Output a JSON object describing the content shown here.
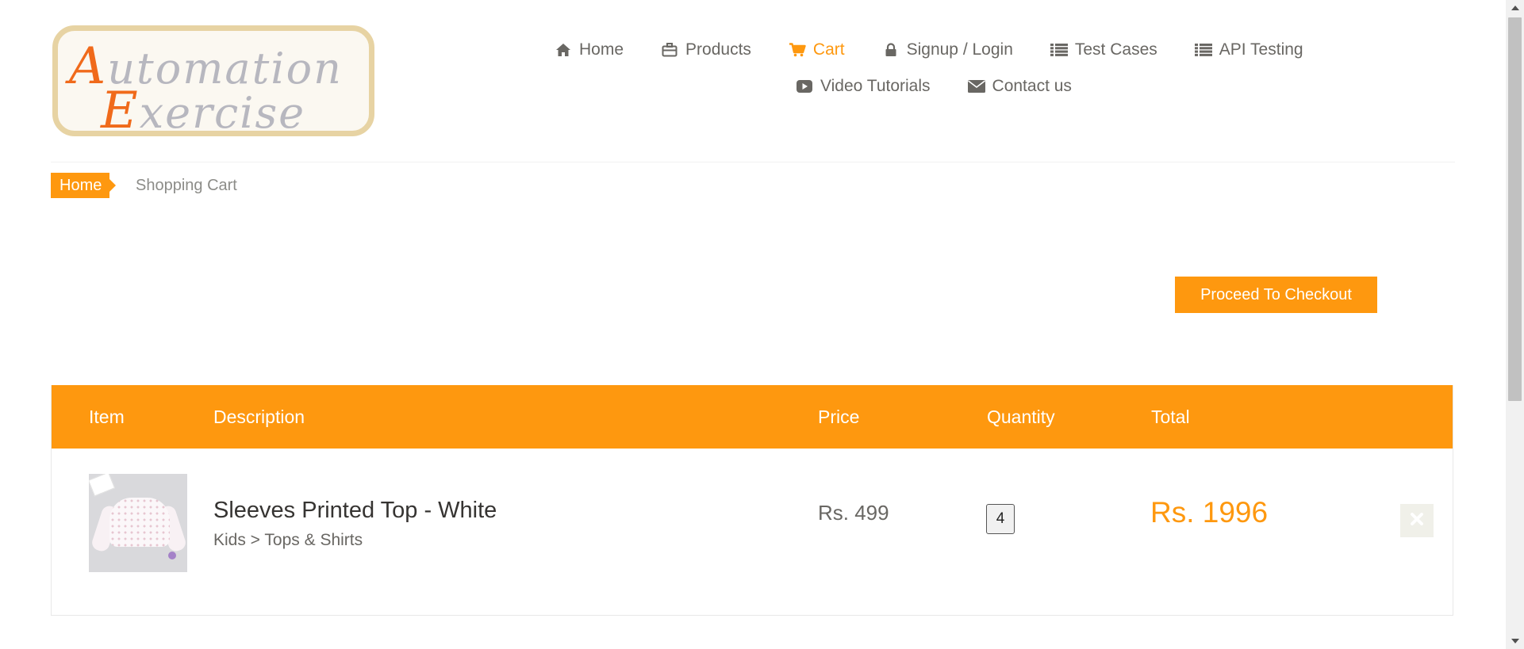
{
  "logo": {
    "line1_cap": "A",
    "line1_rest": "utomation",
    "line2_cap": "E",
    "line2_rest": "xercise"
  },
  "nav": {
    "items": [
      {
        "label": "Home",
        "icon": "home-icon"
      },
      {
        "label": "Products",
        "icon": "briefcase-icon"
      },
      {
        "label": "Cart",
        "icon": "shopping-cart-icon",
        "active": true
      },
      {
        "label": "Signup / Login",
        "icon": "lock-icon"
      },
      {
        "label": "Test Cases",
        "icon": "list-icon"
      },
      {
        "label": "API Testing",
        "icon": "list-icon"
      },
      {
        "label": "Video Tutorials",
        "icon": "youtube-play-icon"
      },
      {
        "label": "Contact us",
        "icon": "envelope-icon"
      }
    ]
  },
  "breadcrumb": {
    "home": "Home",
    "current": "Shopping Cart"
  },
  "checkout": {
    "label": "Proceed To Checkout"
  },
  "cart": {
    "headers": {
      "item": "Item",
      "description": "Description",
      "price": "Price",
      "quantity": "Quantity",
      "total": "Total"
    },
    "rows": [
      {
        "name": "Sleeves Printed Top - White",
        "category": "Kids > Tops & Shirts",
        "price": "Rs. 499",
        "quantity": "4",
        "total": "Rs. 1996",
        "delete_icon": "close-icon"
      }
    ]
  },
  "colors": {
    "accent": "#fe980f",
    "text": "#696763",
    "heading": "#363432"
  }
}
